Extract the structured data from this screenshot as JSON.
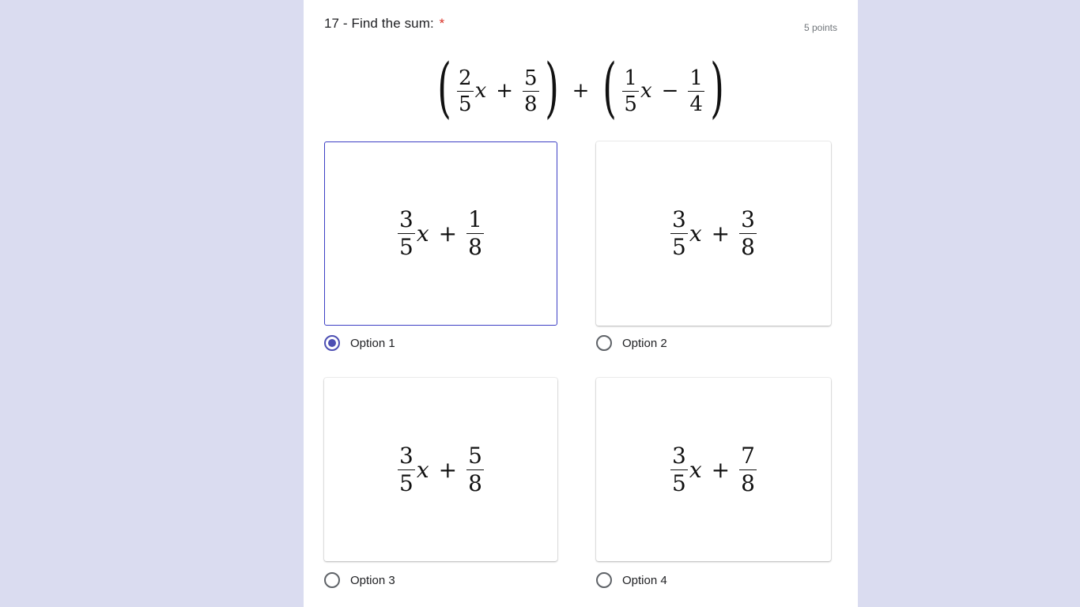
{
  "question": {
    "title": "17 - Find the sum:",
    "required_mark": "*",
    "points": "5 points",
    "expression": {
      "left": {
        "a_num": "2",
        "a_den": "5",
        "var": "x",
        "op": "+",
        "b_num": "5",
        "b_den": "8"
      },
      "middle_op": "+",
      "right": {
        "a_num": "1",
        "a_den": "5",
        "var": "x",
        "op": "−",
        "b_num": "1",
        "b_den": "4"
      }
    }
  },
  "options": [
    {
      "label": "Option 1",
      "selected": true,
      "expr": {
        "a_num": "3",
        "a_den": "5",
        "var": "x",
        "op": "+",
        "b_num": "1",
        "b_den": "8"
      }
    },
    {
      "label": "Option 2",
      "selected": false,
      "expr": {
        "a_num": "3",
        "a_den": "5",
        "var": "x",
        "op": "+",
        "b_num": "3",
        "b_den": "8"
      }
    },
    {
      "label": "Option 3",
      "selected": false,
      "expr": {
        "a_num": "3",
        "a_den": "5",
        "var": "x",
        "op": "+",
        "b_num": "5",
        "b_den": "8"
      }
    },
    {
      "label": "Option 4",
      "selected": false,
      "expr": {
        "a_num": "3",
        "a_den": "5",
        "var": "x",
        "op": "+",
        "b_num": "7",
        "b_den": "8"
      }
    }
  ],
  "colors": {
    "background": "#dadcf0",
    "accent": "#4d4fb3",
    "required": "#d93025"
  }
}
